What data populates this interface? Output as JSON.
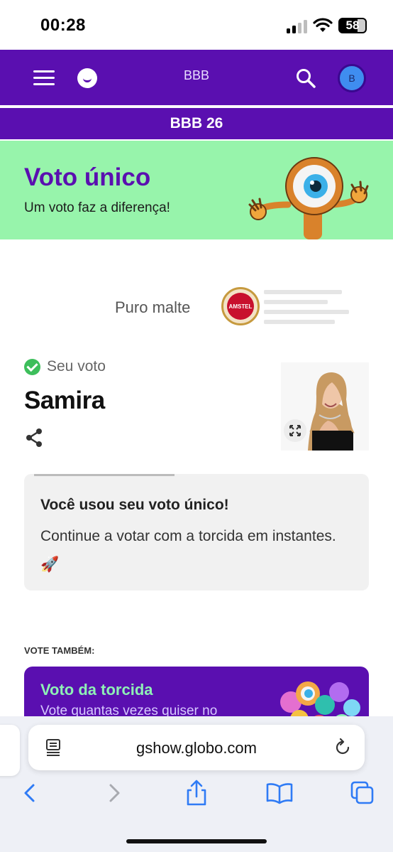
{
  "status_bar": {
    "time": "00:28",
    "battery": "58"
  },
  "header": {
    "title": "BBB",
    "avatar_initial": "B",
    "subtitle": "BBB 26"
  },
  "banner": {
    "heading": "Voto único",
    "subheading": "Um voto faz a diferença!"
  },
  "sponsor": {
    "text": "Puro malte",
    "logo_text": "AMSTEL"
  },
  "vote": {
    "label": "Seu voto",
    "candidate": "Samira"
  },
  "info_card": {
    "title": "Você usou seu voto único!",
    "body": "Continue a votar com a torcida em instantes. 🚀"
  },
  "vote_also": {
    "label": "VOTE TAMBÉM:",
    "card_title": "Voto da torcida",
    "card_subtitle": "Vote quantas vezes quiser no"
  },
  "browser": {
    "url": "gshow.globo.com"
  },
  "colors": {
    "brand_purple": "#5a0fb0",
    "banner_green": "#97f4ab",
    "accent_green": "#8ef0b6",
    "check_green": "#3dbe5b"
  },
  "icons": [
    "menu-icon",
    "globo-logo",
    "search-icon",
    "share-icon",
    "expand-icon",
    "reader-icon",
    "reload-icon",
    "back-icon",
    "forward-icon",
    "share-sheet-icon",
    "bookmarks-icon",
    "tabs-icon"
  ]
}
